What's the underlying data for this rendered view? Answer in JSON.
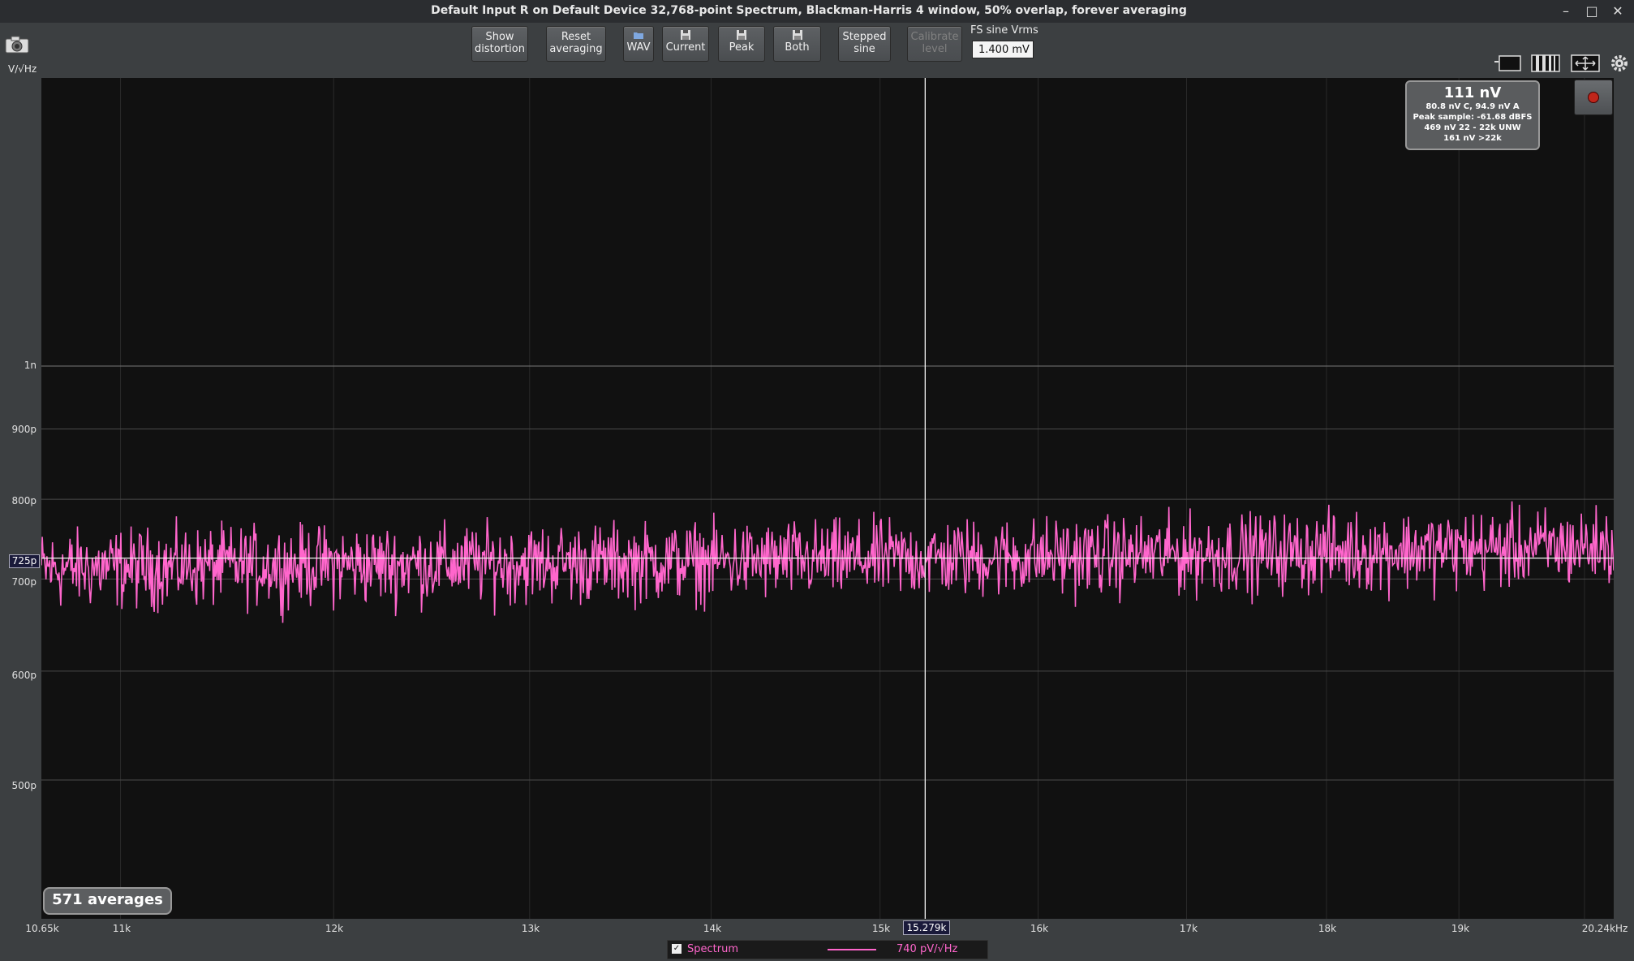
{
  "window": {
    "title": "Default Input R on Default Device 32,768-point Spectrum, Blackman-Harris 4 window, 50% overlap, forever averaging"
  },
  "toolbar": {
    "show_distortion": "Show\ndistortion",
    "reset_averaging": "Reset\naveraging",
    "wav": "WAV",
    "current": "Current",
    "peak": "Peak",
    "both": "Both",
    "stepped_sine": "Stepped\nsine",
    "calibrate_level": "Calibrate\nlevel",
    "fs_label": "FS sine Vrms",
    "fs_value": "1.400 mV"
  },
  "axis": {
    "unit_label": "V/√Hz"
  },
  "info": {
    "main": "111 nV",
    "line1": "80.8 nV C, 94.9 nV A",
    "line2": "Peak sample: -61.68 dBFS",
    "line3": "469 nV 22 - 22k UNW",
    "line4": "161 nV >22k"
  },
  "cursor": {
    "x_label": "15.279k",
    "y_label": "725p"
  },
  "averages": "571 averages",
  "legend": {
    "name": "Spectrum",
    "value": "740 pV/√Hz",
    "checked": true
  },
  "chart_data": {
    "type": "line",
    "xscale": "log",
    "yscale": "log",
    "x_range": [
      10650,
      20240
    ],
    "xtick_labels": [
      "10.65k",
      "11k",
      "12k",
      "13k",
      "14k",
      "15k",
      "16k",
      "17k",
      "18k",
      "19k",
      "20.24kHz"
    ],
    "ytick_labels": [
      "1n",
      "900p",
      "800p",
      "700p",
      "600p",
      "500p"
    ],
    "grid": true,
    "series": [
      {
        "name": "Spectrum",
        "color": "#ff66cc",
        "approx_level": 7.25e-10,
        "trend_values": [
          7.12e-10,
          7.16e-10,
          7.18e-10,
          7.2e-10,
          7.22e-10,
          7.25e-10,
          7.28e-10,
          7.32e-10,
          7.36e-10,
          7.4e-10
        ]
      }
    ],
    "cursor": {
      "x": 15279,
      "y": 7.25e-10
    }
  }
}
